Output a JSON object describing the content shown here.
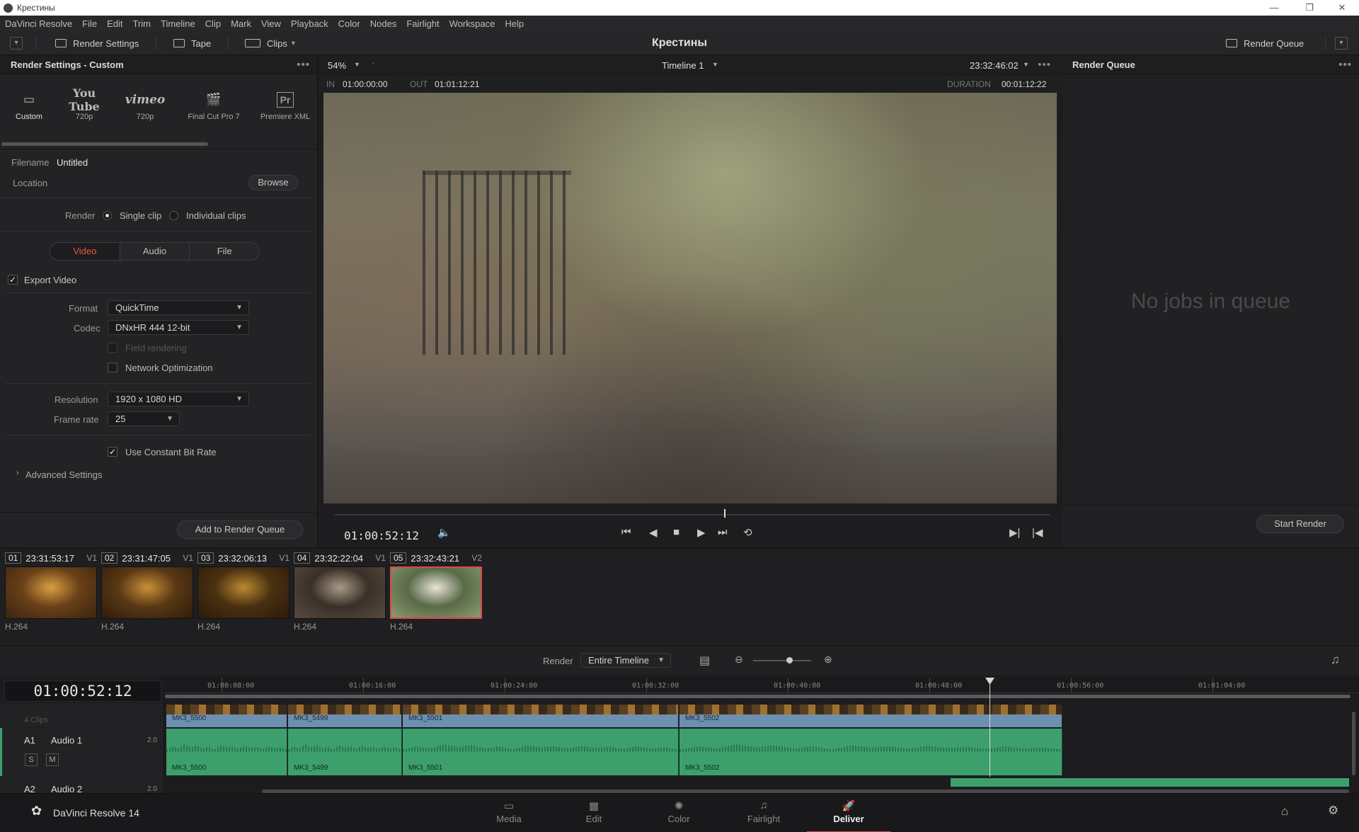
{
  "window": {
    "title": "Крестины",
    "minimize": "—",
    "restore": "❐",
    "close": "✕"
  },
  "menu": [
    "DaVinci Resolve",
    "File",
    "Edit",
    "Trim",
    "Timeline",
    "Clip",
    "Mark",
    "View",
    "Playback",
    "Color",
    "Nodes",
    "Fairlight",
    "Workspace",
    "Help"
  ],
  "toolbar": {
    "render_settings": "Render Settings",
    "tape": "Tape",
    "clips": "Clips",
    "project_title": "Крестины",
    "render_queue": "Render Queue"
  },
  "render_settings": {
    "header": "Render Settings - Custom",
    "presets": [
      {
        "icon": "▭",
        "label": "Custom"
      },
      {
        "icon": "You Tube",
        "label": "720p"
      },
      {
        "icon": "vimeo",
        "label": "720p"
      },
      {
        "icon": "🎬",
        "label": "Final Cut Pro 7"
      },
      {
        "icon": "Pr",
        "label": "Premiere XML"
      }
    ],
    "filename_label": "Filename",
    "filename_value": "Untitled",
    "location_label": "Location",
    "browse": "Browse",
    "render_label": "Render",
    "single_clip": "Single clip",
    "individual_clips": "Individual clips",
    "tabs": [
      "Video",
      "Audio",
      "File"
    ],
    "export_video": "Export Video",
    "format_label": "Format",
    "format_value": "QuickTime",
    "codec_label": "Codec",
    "codec_value": "DNxHR 444 12-bit",
    "field_rendering": "Field rendering",
    "network_optimization": "Network Optimization",
    "resolution_label": "Resolution",
    "resolution_value": "1920 x 1080 HD",
    "framerate_label": "Frame rate",
    "framerate_value": "25",
    "constant_bitrate": "Use Constant Bit Rate",
    "advanced": "Advanced Settings",
    "add_to_queue": "Add to Render Queue"
  },
  "viewer": {
    "zoom": "54%",
    "timeline_name": "Timeline 1",
    "timecode_top": "23:32:46:02",
    "in_label": "IN",
    "in_value": "01:00:00:00",
    "out_label": "OUT",
    "out_value": "01:01:12:21",
    "duration_label": "DURATION",
    "duration_value": "00:01:12:22",
    "current_tc": "01:00:52:12"
  },
  "render_queue": {
    "header": "Render Queue",
    "empty": "No jobs in queue",
    "start": "Start Render"
  },
  "clips": [
    {
      "num": "01",
      "tc": "23:31:53:17",
      "track": "V1",
      "fmt": "H.264",
      "colors": [
        "#3a2410",
        "#d8a040",
        "#6a4018"
      ]
    },
    {
      "num": "02",
      "tc": "23:31:47:05",
      "track": "V1",
      "fmt": "H.264",
      "colors": [
        "#2e1c0c",
        "#c89038",
        "#5a3814"
      ]
    },
    {
      "num": "03",
      "tc": "23:32:06:13",
      "track": "V1",
      "fmt": "H.264",
      "colors": [
        "#2a1a0a",
        "#b88a30",
        "#4a3010"
      ]
    },
    {
      "num": "04",
      "tc": "23:32:22:04",
      "track": "V1",
      "fmt": "H.264",
      "colors": [
        "#5a4a40",
        "#a89a88",
        "#3a3028"
      ]
    },
    {
      "num": "05",
      "tc": "23:32:43:21",
      "track": "V2",
      "fmt": "H.264",
      "colors": [
        "#8a9a70",
        "#e8e4d8",
        "#5a6a48"
      ]
    }
  ],
  "timeline": {
    "render_label": "Render",
    "render_range": "Entire Timeline",
    "timecode": "01:00:52:12",
    "ruler": [
      "01:00:08:00",
      "01:00:16:00",
      "01:00:24:00",
      "01:00:32:00",
      "01:00:40:00",
      "01:00:48:00",
      "01:00:56:00",
      "01:01:04:00"
    ],
    "v_clips_count": "4 Clips",
    "a1_name": "A1",
    "a1_label": "Audio 1",
    "a1_ch": "2.0",
    "a2_name": "A2",
    "a2_label": "Audio 2",
    "a2_ch": "2.0",
    "solo": "S",
    "mute": "M",
    "video_clips": [
      "MK3_5500",
      "MK3_5499",
      "MK3_5501",
      "MK3_5502"
    ],
    "audio_clips": [
      "MK3_5500",
      "MK3_5499",
      "MK3_5501",
      "MK3_5502"
    ]
  },
  "pages": {
    "app_name": "DaVinci Resolve 14",
    "tabs": [
      {
        "icon": "▭",
        "label": "Media"
      },
      {
        "icon": "▦",
        "label": "Edit"
      },
      {
        "icon": "✺",
        "label": "Color"
      },
      {
        "icon": "♫",
        "label": "Fairlight"
      },
      {
        "icon": "🚀",
        "label": "Deliver"
      }
    ]
  }
}
